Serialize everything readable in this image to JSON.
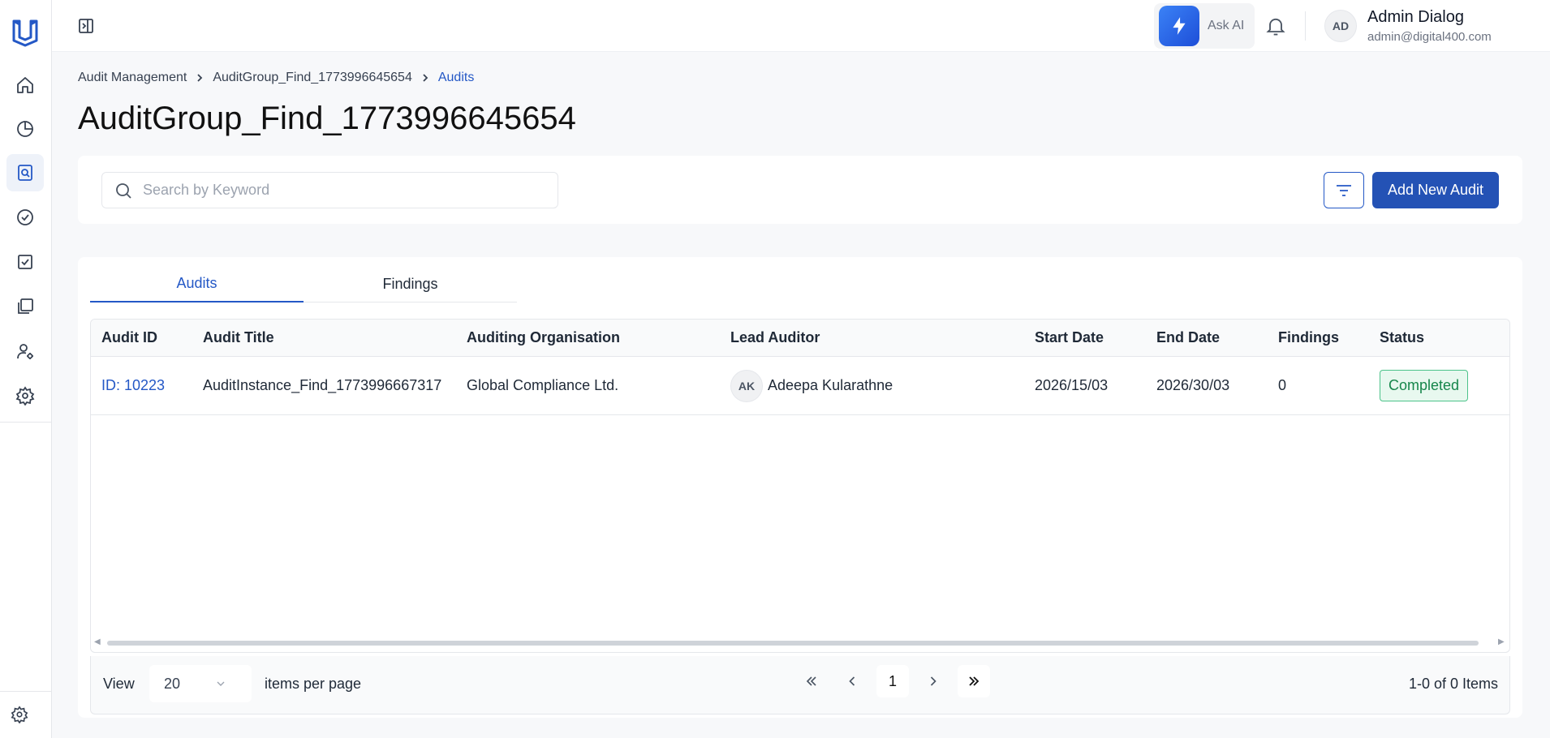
{
  "topbar": {
    "ask_ai_label": "Ask AI",
    "user": {
      "initials": "AD",
      "name": "Admin Dialog",
      "email": "admin@digital400.com"
    }
  },
  "breadcrumb": {
    "items": [
      "Audit Management",
      "AuditGroup_Find_1773996645654",
      "Audits"
    ]
  },
  "page_title": "AuditGroup_Find_1773996645654",
  "search": {
    "placeholder": "Search by Keyword",
    "value": ""
  },
  "actions": {
    "add_label": "Add New Audit"
  },
  "tabs": [
    {
      "label": "Audits",
      "active": true
    },
    {
      "label": "Findings",
      "active": false
    }
  ],
  "table": {
    "headers": [
      "Audit ID",
      "Audit Title",
      "Auditing Organisation",
      "Lead Auditor",
      "Start Date",
      "End Date",
      "Findings",
      "Status"
    ],
    "rows": [
      {
        "id": "ID: 10223",
        "title": "AuditInstance_Find_1773996667317",
        "org": "Global Compliance Ltd.",
        "auditor_initials": "AK",
        "auditor": "Adeepa Kularathne",
        "start": "2026/15/03",
        "end": "2026/30/03",
        "findings": "0",
        "status": "Completed"
      }
    ]
  },
  "pagination": {
    "view_label": "View",
    "per_page": "20",
    "items_label": "items per page",
    "current_page": "1",
    "summary": "1-0 of 0 Items"
  },
  "colors": {
    "accent": "#2458c6",
    "primary_button": "#2452b5",
    "status_completed": "#16864b"
  }
}
